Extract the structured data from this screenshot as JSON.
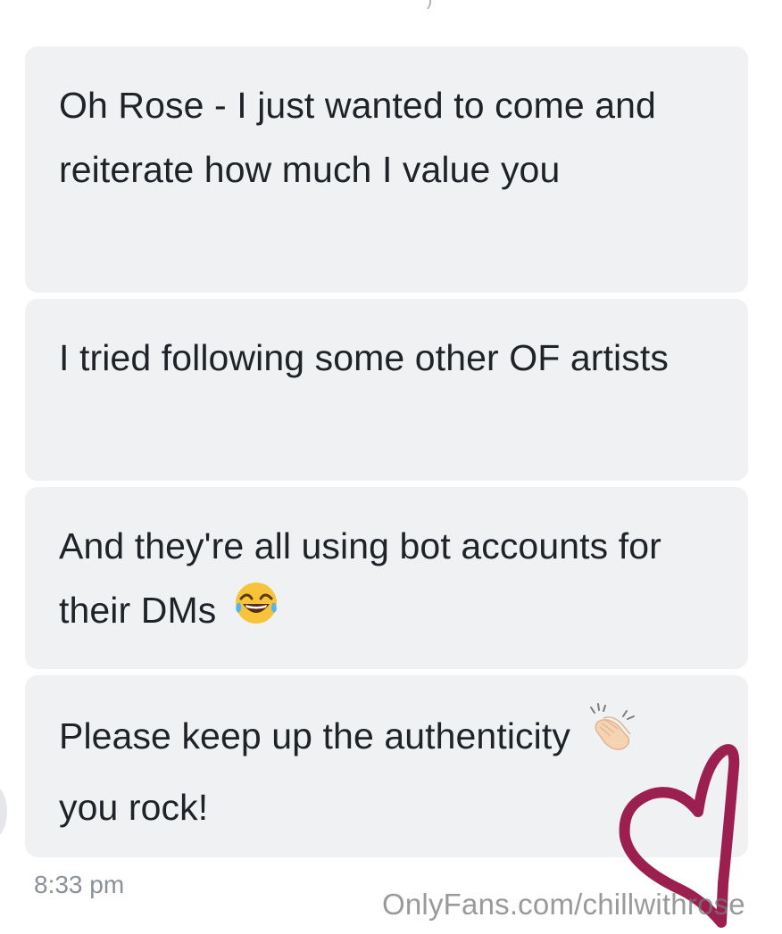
{
  "messages": [
    {
      "text": "Oh Rose - I just wanted to come and reiterate how much I value you"
    },
    {
      "text": "I tried following some other OF artists"
    },
    {
      "text": "And they're all using bot accounts for their DMs",
      "emoji": "face-with-tears-of-joy-icon"
    },
    {
      "text": "Please keep up the authenticity",
      "emoji": "clapping-hands-icon",
      "text2": "you rock!"
    }
  ],
  "timestamp": "8:33 pm",
  "watermark": "OnlyFans.com/chillwithrose",
  "colors": {
    "bubble": "#eff1f3",
    "text": "#1f2328",
    "timestamp": "#8a9199",
    "heart": "#9b1f4f"
  }
}
